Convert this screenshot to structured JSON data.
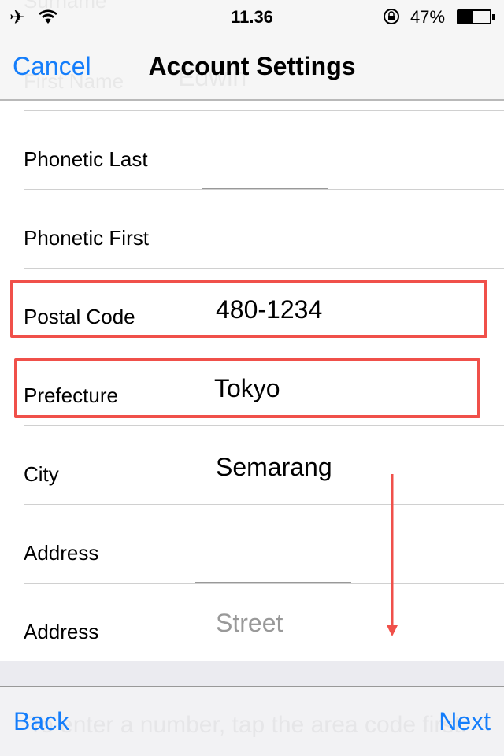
{
  "status_bar": {
    "time": "11.36",
    "battery": "47%",
    "battery_level": 0.47,
    "icons": [
      "airplane-icon",
      "wifi-icon",
      "rotation-lock-icon",
      "battery-icon"
    ]
  },
  "ghost": {
    "surname_label": "Surname",
    "first_name_label": "First Name",
    "first_name_value": "Edwin",
    "hint": "To enter a number, tap the area code first."
  },
  "nav": {
    "cancel": "Cancel",
    "title": "Account Settings"
  },
  "rows": [
    {
      "label": "Phonetic Last",
      "value": ""
    },
    {
      "label": "Phonetic First",
      "value": ""
    },
    {
      "label": "Postal Code",
      "value": "480-1234"
    },
    {
      "label": "Prefecture",
      "value": "Tokyo"
    },
    {
      "label": "City",
      "value": "Semarang"
    },
    {
      "label": "Address",
      "value": ""
    },
    {
      "label": "Address",
      "value": "",
      "placeholder": "Street"
    }
  ],
  "toolbar": {
    "back": "Back",
    "next": "Next"
  },
  "colors": {
    "accent": "#157efb",
    "annotation": "#f0504a"
  }
}
